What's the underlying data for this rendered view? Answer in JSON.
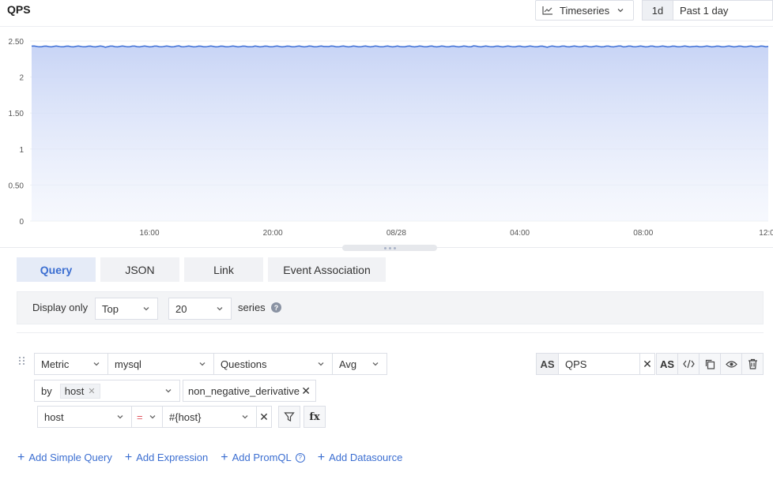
{
  "header": {
    "title": "QPS",
    "viz_type": "Timeseries",
    "time_short": "1d",
    "time_range": "Past 1 day"
  },
  "chart_data": {
    "type": "area",
    "y_ticks": [
      "2.50",
      "2",
      "1.50",
      "1",
      "0.50",
      "0"
    ],
    "x_ticks": [
      "16:00",
      "20:00",
      "08/28",
      "04:00",
      "08:00",
      "12:0"
    ],
    "ylim": [
      0,
      2.5
    ],
    "series": [
      {
        "values": [
          2.43,
          2.42,
          2.43,
          2.42,
          2.43,
          2.42,
          2.43,
          2.42,
          2.43,
          2.42,
          2.43
        ]
      }
    ],
    "color": "#3d6fd6",
    "grid": true
  },
  "tabs": [
    {
      "label": "Query",
      "active": true
    },
    {
      "label": "JSON",
      "active": false
    },
    {
      "label": "Link",
      "active": false
    },
    {
      "label": "Event Association",
      "active": false
    }
  ],
  "display": {
    "label": "Display only",
    "order": "Top",
    "count": "20",
    "suffix": "series"
  },
  "query": {
    "type": "Metric",
    "measurement": "mysql",
    "field": "Questions",
    "aggregation": "Avg",
    "by_label": "by",
    "group_by_tag": "host",
    "function": "non_negative_derivative",
    "filter_key": "host",
    "filter_op": "=",
    "filter_value": "#{host}",
    "as_label": "AS",
    "alias": "QPS",
    "fx_label": "fx"
  },
  "actions": [
    {
      "label": "Add Simple Query"
    },
    {
      "label": "Add Expression"
    },
    {
      "label": "Add PromQL"
    },
    {
      "label": "Add Datasource"
    }
  ]
}
